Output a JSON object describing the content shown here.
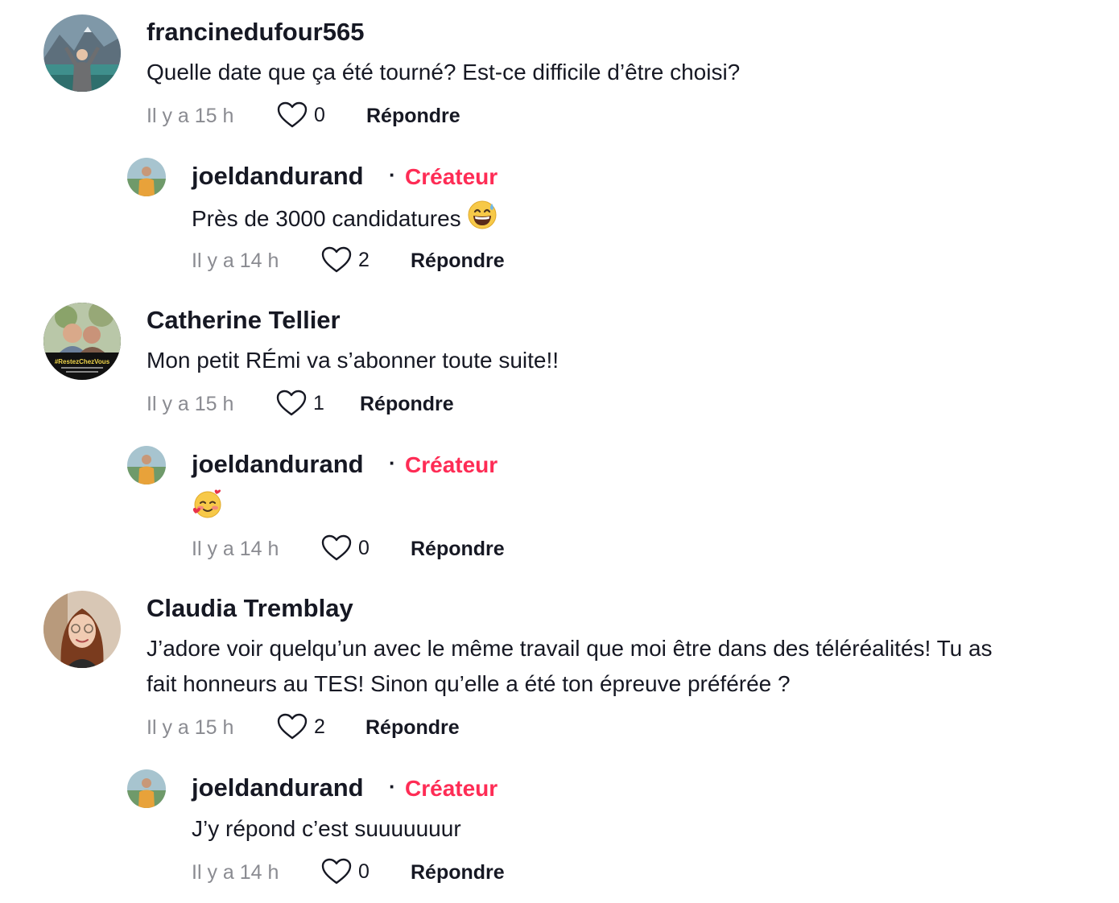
{
  "comments": [
    {
      "username": "francinedufour565",
      "text": "Quelle date que ça été tourné? Est-ce difficile d’être choisi?",
      "time": "Il y a 15 h",
      "likes": "0",
      "reply_label": "Répondre",
      "reply": {
        "username": "joeldandurand",
        "separator": "·",
        "badge": "Créateur",
        "text": "Près de 3000 candidatures",
        "emoji": "grinning-sweat-emoji",
        "time": "Il y a 14 h",
        "likes": "2",
        "reply_label": "Répondre"
      }
    },
    {
      "username": "Catherine Tellier",
      "text": "Mon petit RÉmi va s’abonner toute suite!!",
      "time": "Il y a 15 h",
      "likes": "1",
      "reply_label": "Répondre",
      "avatar_text": "#RestezChezVous",
      "reply": {
        "username": "joeldandurand",
        "separator": "·",
        "badge": "Créateur",
        "text": "",
        "emoji": "smiling-hearts-emoji",
        "time": "Il y a 14 h",
        "likes": "0",
        "reply_label": "Répondre"
      }
    },
    {
      "username": "Claudia Tremblay",
      "text_line1": "J’adore voir quelqu’un avec le même travail que moi être dans des téléréalités! Tu as",
      "text_line2": "fait honneurs au TES! Sinon qu’elle a été ton épreuve préférée ?",
      "time": "Il y a 15 h",
      "likes": "2",
      "reply_label": "Répondre",
      "reply": {
        "username": "joeldandurand",
        "separator": "·",
        "badge": "Créateur",
        "text": "J’y répond c’est suuuuuuur",
        "time": "Il y a 14 h",
        "likes": "0",
        "reply_label": "Répondre"
      }
    }
  ],
  "colors": {
    "creator_badge": "#fe2c55",
    "text": "#161823",
    "muted": "#8a8b91"
  }
}
